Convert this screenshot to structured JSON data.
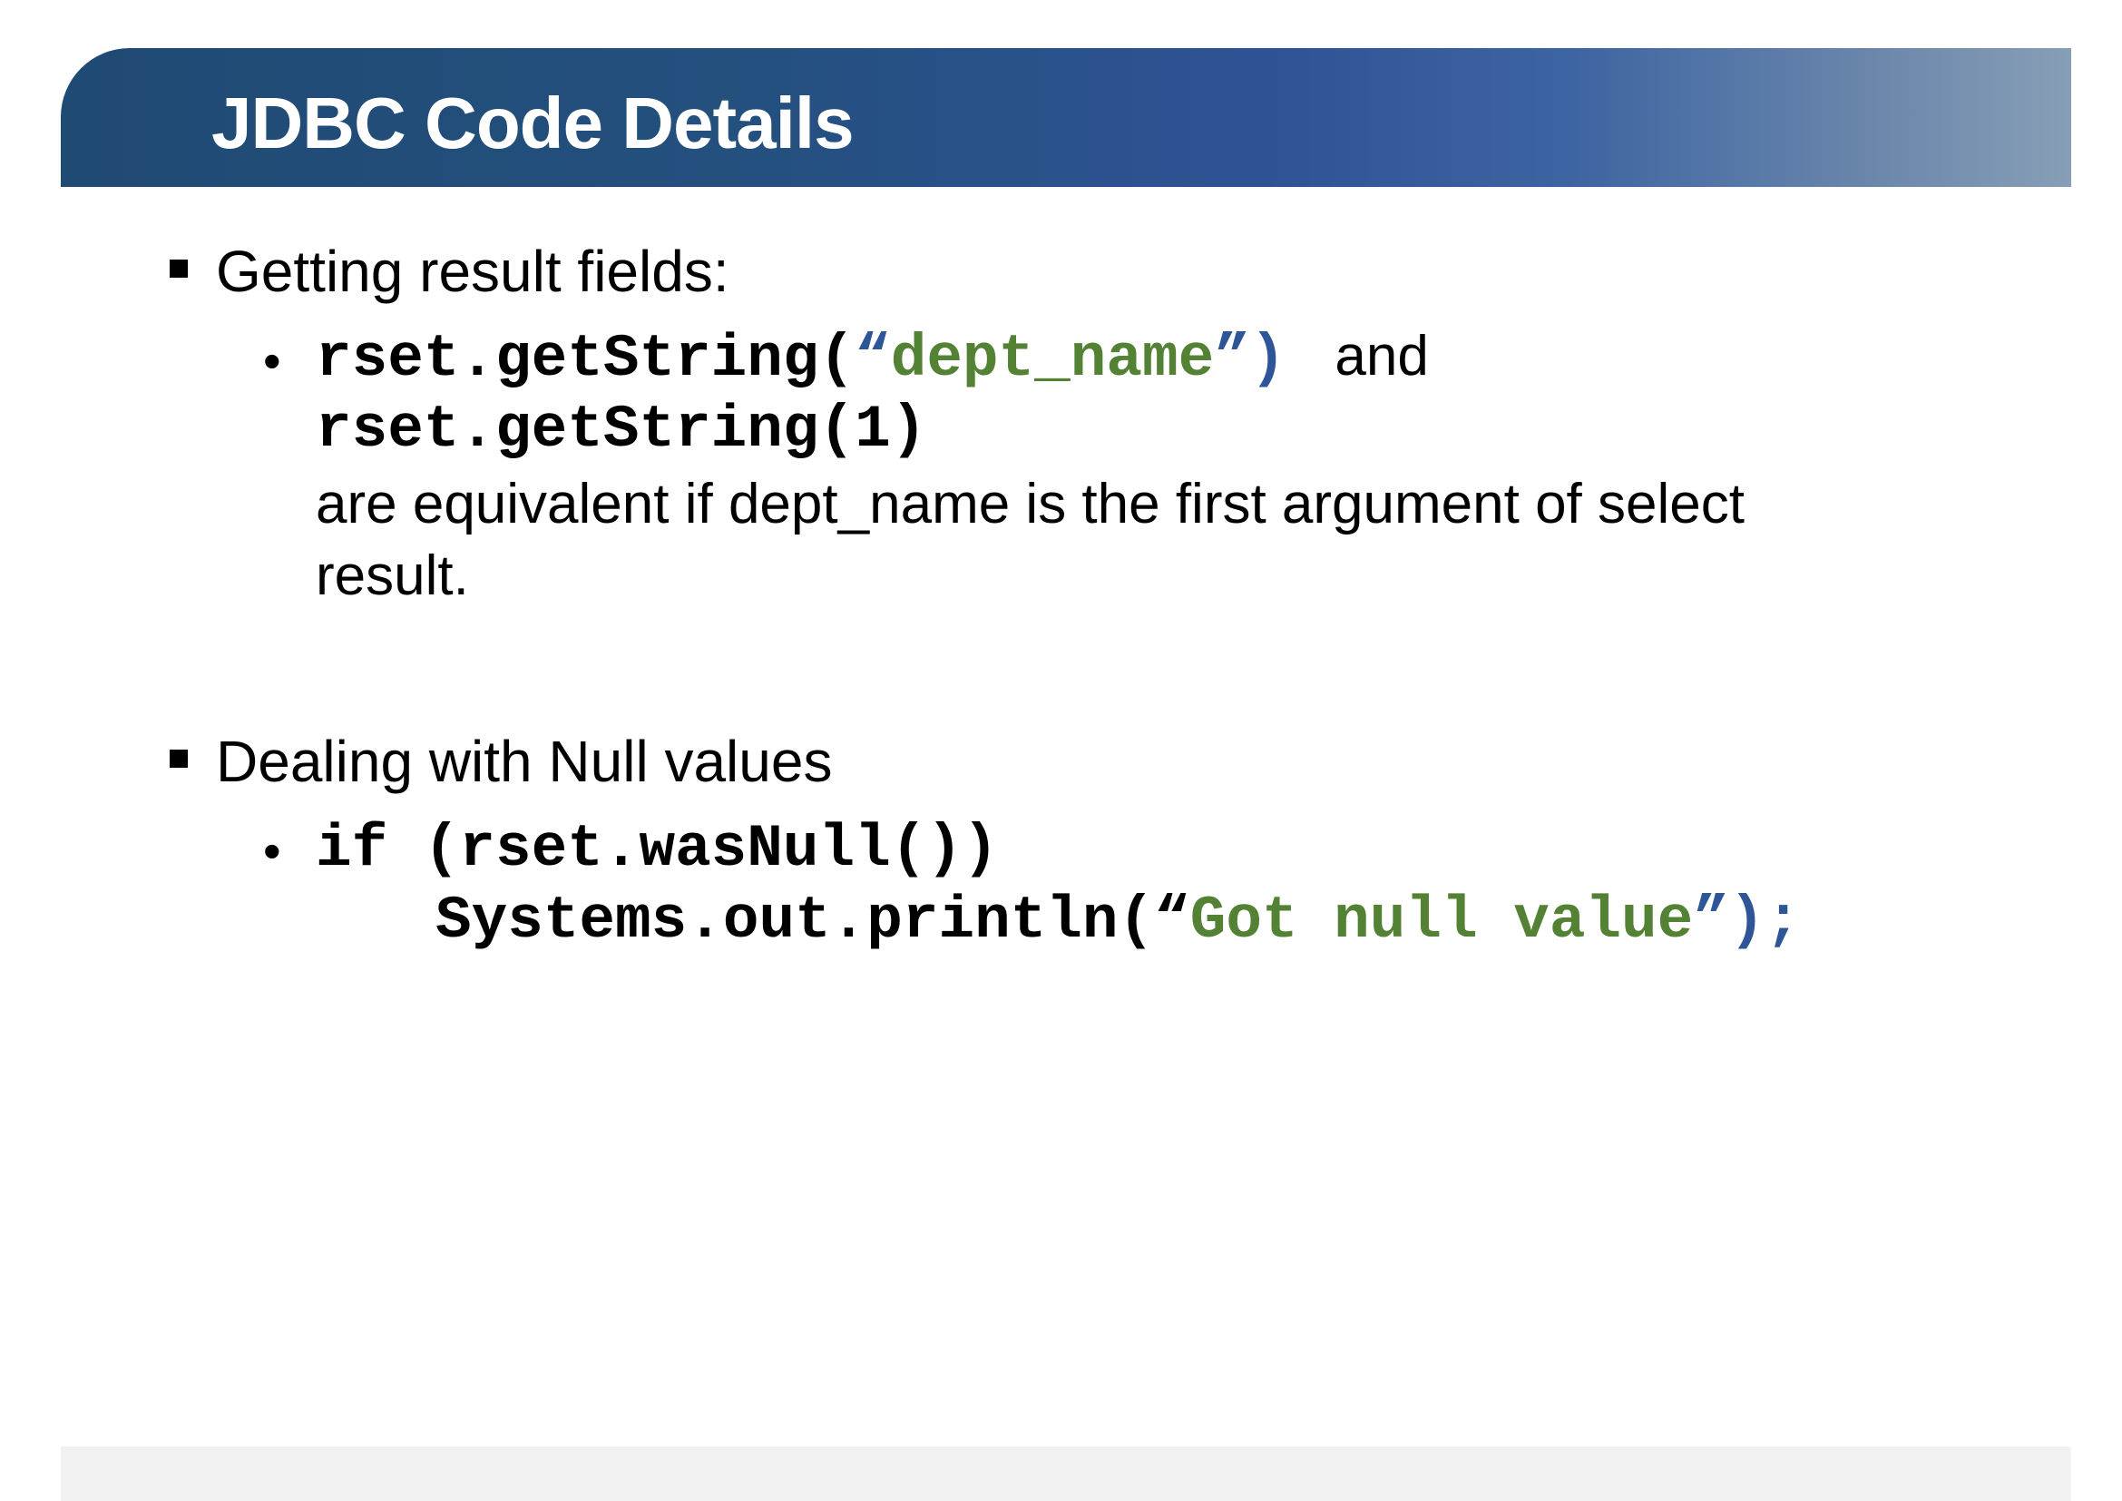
{
  "slide": {
    "title": "JDBC Code Details"
  },
  "section1": {
    "heading": "Getting result fields:",
    "line1": {
      "code_prefix": "rset.getString(",
      "string_open": "“",
      "string_value": "dept_name",
      "string_close": "”)",
      "conjunction": "and"
    },
    "line2_code": "rset.getString(1)",
    "explanation_line1": "are equivalent if dept_name is the first argument of select",
    "explanation_line2": "result."
  },
  "section2": {
    "heading": "Dealing with Null values",
    "line1_code": "if (rset.wasNull())",
    "line2": {
      "code_prefix": "Systems.out.println(",
      "string_open": "“",
      "string_value": "Got null value",
      "string_close": "”);"
    }
  },
  "colors": {
    "title_bar_start": "#1f4a73",
    "title_bar_end": "#879eb6",
    "string_literal": "#548235",
    "punctuation_accent": "#2e5597",
    "footer_bar": "#f2f2f2"
  }
}
